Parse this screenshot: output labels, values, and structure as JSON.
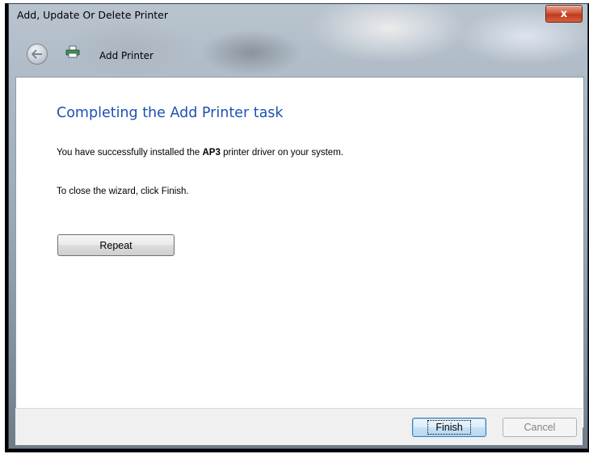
{
  "window": {
    "title": "Add, Update Or Delete Printer",
    "close_label": "x"
  },
  "nav": {
    "back_icon": "back-arrow-icon",
    "printer_icon": "printer-icon",
    "label": "Add Printer"
  },
  "content": {
    "heading": "Completing the Add Printer task",
    "message_prefix": "You have successfully installed the ",
    "driver_name": "AP3",
    "message_suffix": " printer driver on your system.",
    "close_instruction": "To close the wizard, click Finish.",
    "repeat_label": "Repeat"
  },
  "footer": {
    "finish_label": "Finish",
    "cancel_label": "Cancel"
  },
  "colors": {
    "heading": "#1c51b5",
    "close_button": "#c03a1c",
    "finish_border": "#3c7fb1"
  }
}
